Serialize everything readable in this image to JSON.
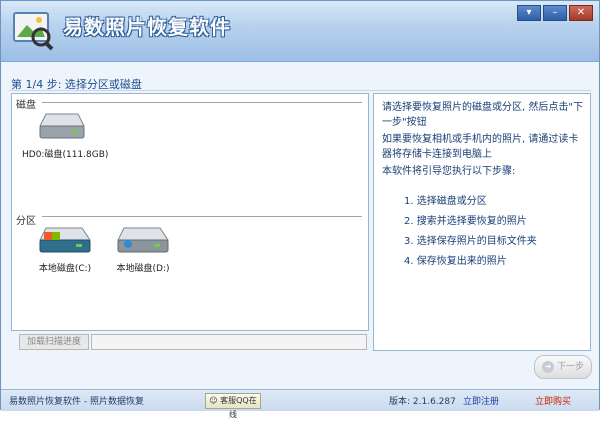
{
  "window": {
    "title": "易数照片恢复软件",
    "controls": [
      "▾",
      "–",
      "✕"
    ]
  },
  "step": {
    "title": "第 1/4 步:  选择分区或磁盘"
  },
  "disks": {
    "section_label": "磁盘",
    "items": [
      {
        "label": "HD0:磁盘(111.8GB)",
        "icon": "hard-disk-icon"
      }
    ]
  },
  "partitions": {
    "section_label": "分区",
    "items": [
      {
        "label": "本地磁盘(C:)",
        "icon": "system-drive-icon"
      },
      {
        "label": "本地磁盘(D:)",
        "icon": "local-drive-icon"
      }
    ]
  },
  "instructions": {
    "p1": "请选择要恢复照片的磁盘或分区, 然后点击\"下一步\"按钮",
    "p2": "如果要恢复相机或手机内的照片, 请通过读卡器将存储卡连接到电脑上",
    "p3": "本软件将引导您执行以下步骤:",
    "steps": [
      "1.  选择磁盘或分区",
      "2.  搜索并选择要恢复的照片",
      "3.  选择保存照片的目标文件夹",
      "4.  保存恢复出来的照片"
    ]
  },
  "progress": {
    "label": "加载扫描进度",
    "percent": 0
  },
  "buttons": {
    "next": "下一步"
  },
  "status": {
    "app": "易数照片恢复软件 - 照片数据恢复",
    "qq": "客服QQ在线",
    "version": "版本: 2.1.6.287",
    "register": "立即注册",
    "buy": "立即购买"
  },
  "colors": {
    "accent": "#1e4e8c",
    "link_red": "#cc2200"
  }
}
